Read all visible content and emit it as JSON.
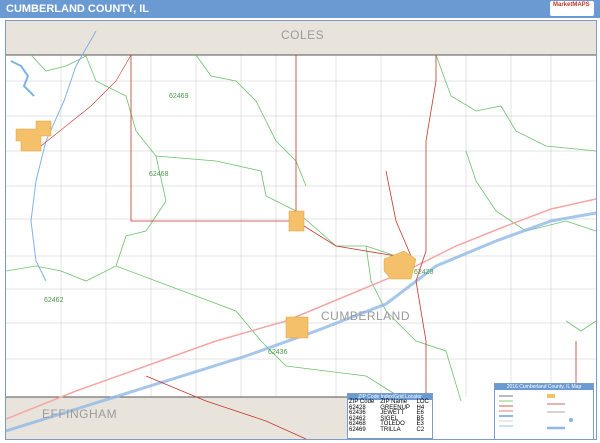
{
  "header": {
    "title": "CUMBERLAND COUNTY, IL",
    "logo_text": "MarketMAPS"
  },
  "map": {
    "county_labels": {
      "coles": "COLES",
      "cumberland": "CUMBERLAND",
      "effingham": "EFFINGHAM"
    },
    "zip_labels": {
      "z1": "62469",
      "z2": "62468",
      "z3": "62462",
      "z4": "62428",
      "z5": "62436"
    },
    "colors": {
      "county_line": "#555555",
      "zip_line": "#6cc06c",
      "road": "#c0392b",
      "highway": "#f4a6a6",
      "river": "#7fb3e8",
      "town": "#f4c06a",
      "outside": "#e8e4dc"
    }
  },
  "zip_legend": {
    "title": "ZIP Code Index/Grid Locator",
    "headers": [
      "ZIP Code",
      "ZIP Name",
      "LOC"
    ],
    "rows": [
      [
        "62428",
        "GREENUP",
        "H4"
      ],
      [
        "62436",
        "JEWETT",
        "E6"
      ],
      [
        "62462",
        "SIGEL",
        "B5"
      ],
      [
        "62468",
        "TOLEDO",
        "E3"
      ],
      [
        "62469",
        "TRILLA",
        "C2"
      ]
    ]
  },
  "map_legend": {
    "title": "2016 Cumberland County, IL Map"
  }
}
